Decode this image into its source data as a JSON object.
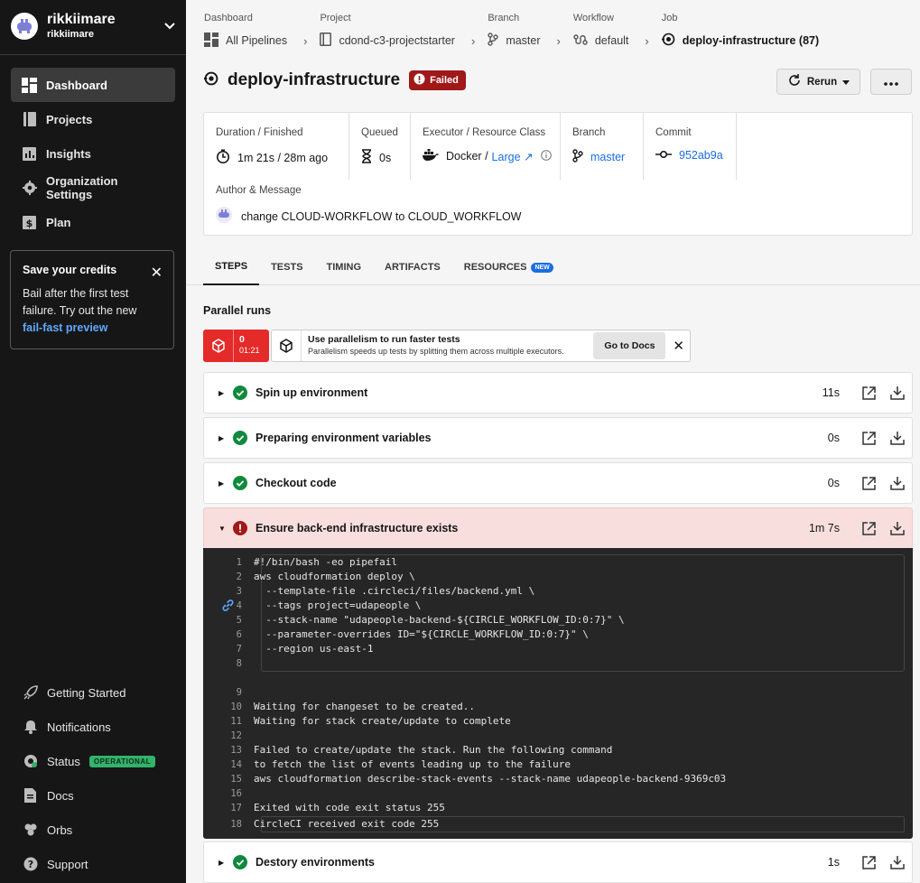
{
  "org": {
    "name": "rikkiimare",
    "sub": "rikkiimare"
  },
  "sidebar": {
    "items": [
      {
        "label": "Dashboard",
        "icon": "dashboard-icon"
      },
      {
        "label": "Projects",
        "icon": "projects-icon"
      },
      {
        "label": "Insights",
        "icon": "insights-icon"
      },
      {
        "label": "Organization Settings",
        "icon": "gear-icon"
      },
      {
        "label": "Plan",
        "icon": "dollar-icon"
      }
    ],
    "credits": {
      "title": "Save your credits",
      "body": "Bail after the first test failure. Try out the new",
      "link": "fail-fast preview"
    },
    "bottom": [
      {
        "label": "Getting Started",
        "icon": "rocket-icon"
      },
      {
        "label": "Notifications",
        "icon": "bell-icon"
      },
      {
        "label": "Status",
        "icon": "status-icon",
        "badge": "OPERATIONAL"
      },
      {
        "label": "Docs",
        "icon": "docs-icon"
      },
      {
        "label": "Orbs",
        "icon": "orbs-icon"
      },
      {
        "label": "Support",
        "icon": "help-icon"
      }
    ]
  },
  "breadcrumb": {
    "dashboard": {
      "label": "Dashboard",
      "value": "All Pipelines"
    },
    "project": {
      "label": "Project",
      "value": "cdond-c3-projectstarter"
    },
    "branch": {
      "label": "Branch",
      "value": "master"
    },
    "workflow": {
      "label": "Workflow",
      "value": "default"
    },
    "job": {
      "label": "Job",
      "value": "deploy-infrastructure (87)"
    }
  },
  "job": {
    "title": "deploy-infrastructure",
    "status": "Failed",
    "rerun": "Rerun"
  },
  "info": {
    "duration": {
      "label": "Duration / Finished",
      "value": "1m 21s / 28m ago"
    },
    "queued": {
      "label": "Queued",
      "value": "0s"
    },
    "executor": {
      "label": "Executor / Resource Class",
      "value": "Docker /",
      "link": "Large"
    },
    "branch": {
      "label": "Branch",
      "value": "master"
    },
    "commit": {
      "label": "Commit",
      "value": "952ab9a"
    },
    "author": {
      "label": "Author & Message",
      "message": "change CLOUD-WORKFLOW to CLOUD_WORKFLOW"
    }
  },
  "tabs": [
    {
      "label": "STEPS"
    },
    {
      "label": "TESTS"
    },
    {
      "label": "TIMING"
    },
    {
      "label": "ARTIFACTS"
    },
    {
      "label": "RESOURCES",
      "badge": "NEW"
    }
  ],
  "parallel": {
    "title": "Parallel runs",
    "run": {
      "index": "0",
      "time": "01:21"
    },
    "tip_title": "Use parallelism to run faster tests",
    "tip_body": "Parallelism speeds up tests by splitting them across multiple executors.",
    "docs_button": "Go to Docs"
  },
  "steps": [
    {
      "name": "Spin up environment",
      "duration": "11s",
      "status": "success"
    },
    {
      "name": "Preparing environment variables",
      "duration": "0s",
      "status": "success"
    },
    {
      "name": "Checkout code",
      "duration": "0s",
      "status": "success"
    },
    {
      "name": "Ensure back-end infrastructure exists",
      "duration": "1m 7s",
      "status": "failed"
    },
    {
      "name": "Destory environments",
      "duration": "1s",
      "status": "success"
    }
  ],
  "terminal": {
    "lines": [
      {
        "n": "1",
        "text": "#!/bin/bash -eo pipefail"
      },
      {
        "n": "2",
        "text": "aws cloudformation deploy \\"
      },
      {
        "n": "3",
        "text": "  --template-file .circleci/files/backend.yml \\"
      },
      {
        "n": "4",
        "text": "  --tags project=udapeople \\"
      },
      {
        "n": "5",
        "text": "  --stack-name \"udapeople-backend-${CIRCLE_WORKFLOW_ID:0:7}\" \\"
      },
      {
        "n": "6",
        "text": "  --parameter-overrides ID=\"${CIRCLE_WORKFLOW_ID:0:7}\" \\"
      },
      {
        "n": "7",
        "text": "  --region us-east-1"
      },
      {
        "n": "8",
        "text": ""
      },
      {
        "n": "9",
        "text": ""
      },
      {
        "n": "10",
        "text": "Waiting for changeset to be created.."
      },
      {
        "n": "11",
        "text": "Waiting for stack create/update to complete"
      },
      {
        "n": "12",
        "text": ""
      },
      {
        "n": "13",
        "text": "Failed to create/update the stack. Run the following command"
      },
      {
        "n": "14",
        "text": "to fetch the list of events leading up to the failure"
      },
      {
        "n": "15",
        "text": "aws cloudformation describe-stack-events --stack-name udapeople-backend-9369c03"
      },
      {
        "n": "16",
        "text": ""
      },
      {
        "n": "17",
        "text": "Exited with code exit status 255"
      },
      {
        "n": "18",
        "text": "CircleCI received exit code 255"
      }
    ]
  },
  "colors": {
    "success": "#0f8a3c",
    "failed": "#a01818",
    "link": "#1b6ee0",
    "sidebar": "#161616"
  }
}
